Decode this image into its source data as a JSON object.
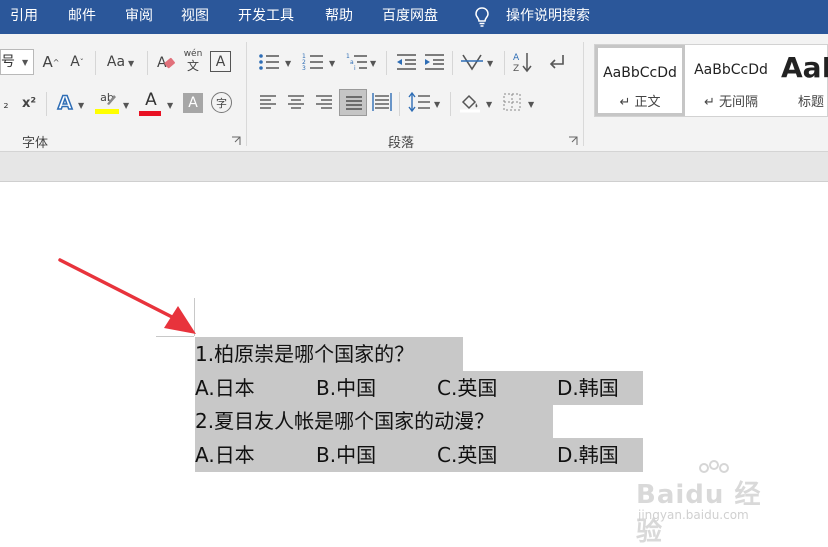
{
  "menubar": {
    "tabs": [
      "引用",
      "邮件",
      "审阅",
      "视图",
      "开发工具",
      "帮助",
      "百度网盘"
    ],
    "tell_me": "操作说明搜索"
  },
  "ribbon": {
    "font_group_label": "字体",
    "paragraph_group_label": "段落",
    "font_size_value": "号",
    "grow_font": "A",
    "shrink_font": "A",
    "change_case": "Aa",
    "phonetic_top": "wén",
    "phonetic_bottom": "文",
    "char_border": "A",
    "subscript": "₂",
    "superscript": "x²",
    "text_effects": "A",
    "highlight": "ab",
    "font_color": "A",
    "char_shading": "A",
    "enclose_char": "字"
  },
  "styles": [
    {
      "sample": "AaBbCcDd",
      "name": "↵ 正文"
    },
    {
      "sample": "AaBbCcDd",
      "name": "↵ 无间隔"
    },
    {
      "sample": "AaI",
      "name": "标题"
    }
  ],
  "document": {
    "q1": "1.柏原崇是哪个国家的？",
    "q1_options": [
      "A.日本",
      "B.中国",
      "C.英国",
      "D.韩国"
    ],
    "q2": "2.夏目友人帐是哪个国家的动漫？",
    "q2_options": [
      "A.日本",
      "B.中国",
      "C.英国",
      "D.韩国"
    ]
  },
  "watermark": {
    "brand": "Baidu 经验",
    "url": "jingyan.baidu.com"
  },
  "colors": {
    "menubar": "#2b579a",
    "highlight_yellow": "#ffff00",
    "font_red": "#e81123",
    "arrow_red": "#e8333c",
    "selection": "#c8c8c8"
  }
}
